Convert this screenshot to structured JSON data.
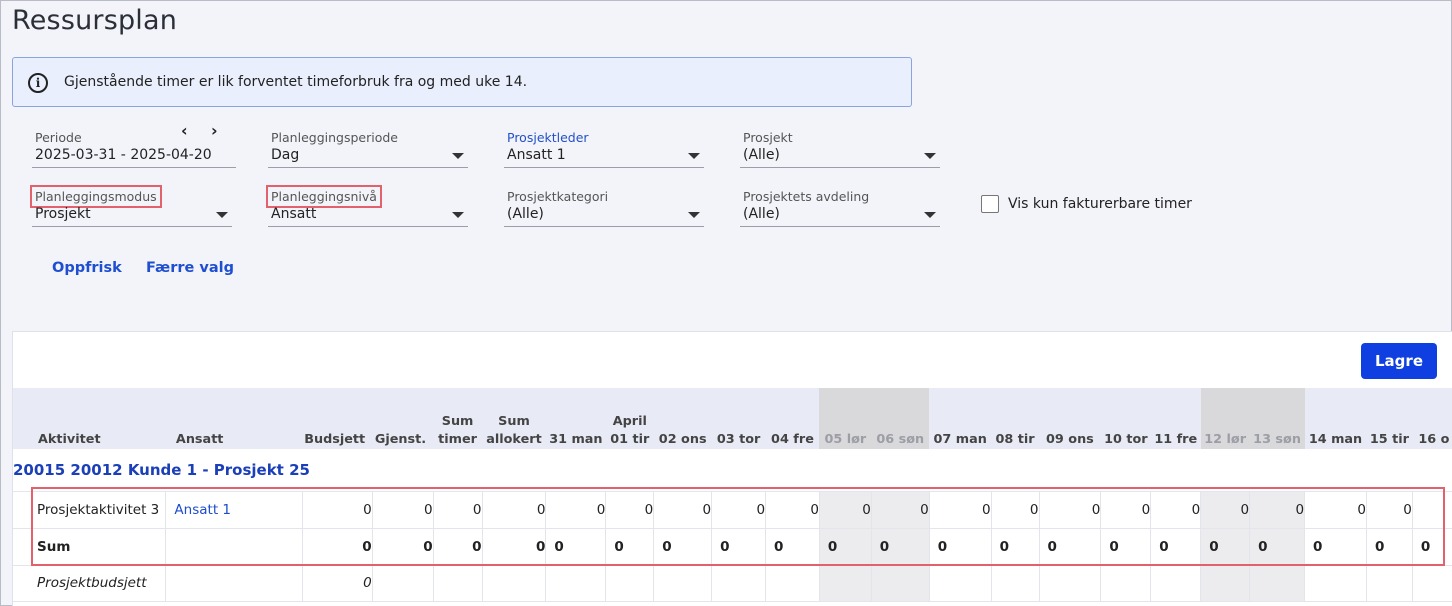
{
  "title": "Ressursplan",
  "info": {
    "text": "Gjenstående timer er lik forventet timeforbruk fra og med uke 14."
  },
  "filters": {
    "periode": {
      "label": "Periode",
      "value": "2025-03-31 - 2025-04-20"
    },
    "planleggingsperiode": {
      "label": "Planleggingsperiode",
      "value": "Dag"
    },
    "prosjektleder": {
      "label": "Prosjektleder",
      "value": "Ansatt 1"
    },
    "prosjekt": {
      "label": "Prosjekt",
      "value": "(Alle)"
    },
    "planleggingsmodus": {
      "label": "Planleggingsmodus",
      "value": "Prosjekt"
    },
    "planleggingsniva": {
      "label": "Planleggingsnivå",
      "value": "Ansatt"
    },
    "prosjektkategori": {
      "label": "Prosjektkategori",
      "value": "(Alle)"
    },
    "avdeling": {
      "label": "Prosjektets avdeling",
      "value": "(Alle)"
    },
    "prev": "‹",
    "next": "›"
  },
  "checkbox": {
    "label": "Vis kun fakturerbare timer",
    "checked": false
  },
  "actions": {
    "refresh": "Oppfrisk",
    "fewer": "Færre valg",
    "save": "Lagre"
  },
  "columns": [
    "Aktivitet",
    "Ansatt",
    "Budsjett",
    "Gjenst.",
    "Sum timer",
    "Sum allokert",
    "31 man",
    "April 01 tir",
    "02 ons",
    "03 tor",
    "04 fre",
    "05 lør",
    "06 søn",
    "07 man",
    "08 tir",
    "09 ons",
    "10 tor",
    "11 fre",
    "12 lør",
    "13 søn",
    "14 man",
    "15 tir",
    "16 o"
  ],
  "header": {
    "c0": "Aktivitet",
    "c1": "Ansatt",
    "c2": "Budsjett",
    "c3": "Gjenst.",
    "c4a": "Sum",
    "c4b": "timer",
    "c5a": "Sum",
    "c5b": "allokert",
    "c6": "31 man",
    "c7a": "April",
    "c7b": "01 tir",
    "c8": "02 ons",
    "c9": "03 tor",
    "c10": "04 fre",
    "c11": "05 lør",
    "c12": "06 søn",
    "c13": "07 man",
    "c14": "08 tir",
    "c15": "09 ons",
    "c16": "10 tor",
    "c17": "11 fre",
    "c18": "12 lør",
    "c19": "13 søn",
    "c20": "14 man",
    "c21": "15 tir",
    "c22": "16 o"
  },
  "project": {
    "label": "20015 20012 Kunde 1 - Prosjekt 25"
  },
  "rows": {
    "activity": {
      "name": "Prosjektaktivitet 3",
      "employee": "Ansatt 1",
      "values": [
        "0",
        "0",
        "0",
        "0",
        "0",
        "0",
        "0",
        "0",
        "0",
        "0",
        "0",
        "0",
        "0",
        "0",
        "0",
        "0",
        "0",
        "0",
        "0",
        "0"
      ]
    },
    "sum": {
      "label": "Sum",
      "values": [
        "0",
        "0",
        "0",
        "0",
        "0",
        "0",
        "0",
        "0",
        "0",
        "0",
        "0",
        "0",
        "0",
        "0",
        "0",
        "0",
        "0",
        "0",
        "0",
        "0",
        "0"
      ]
    },
    "budget": {
      "label": "Prosjektbudsjett",
      "value": "0"
    }
  }
}
